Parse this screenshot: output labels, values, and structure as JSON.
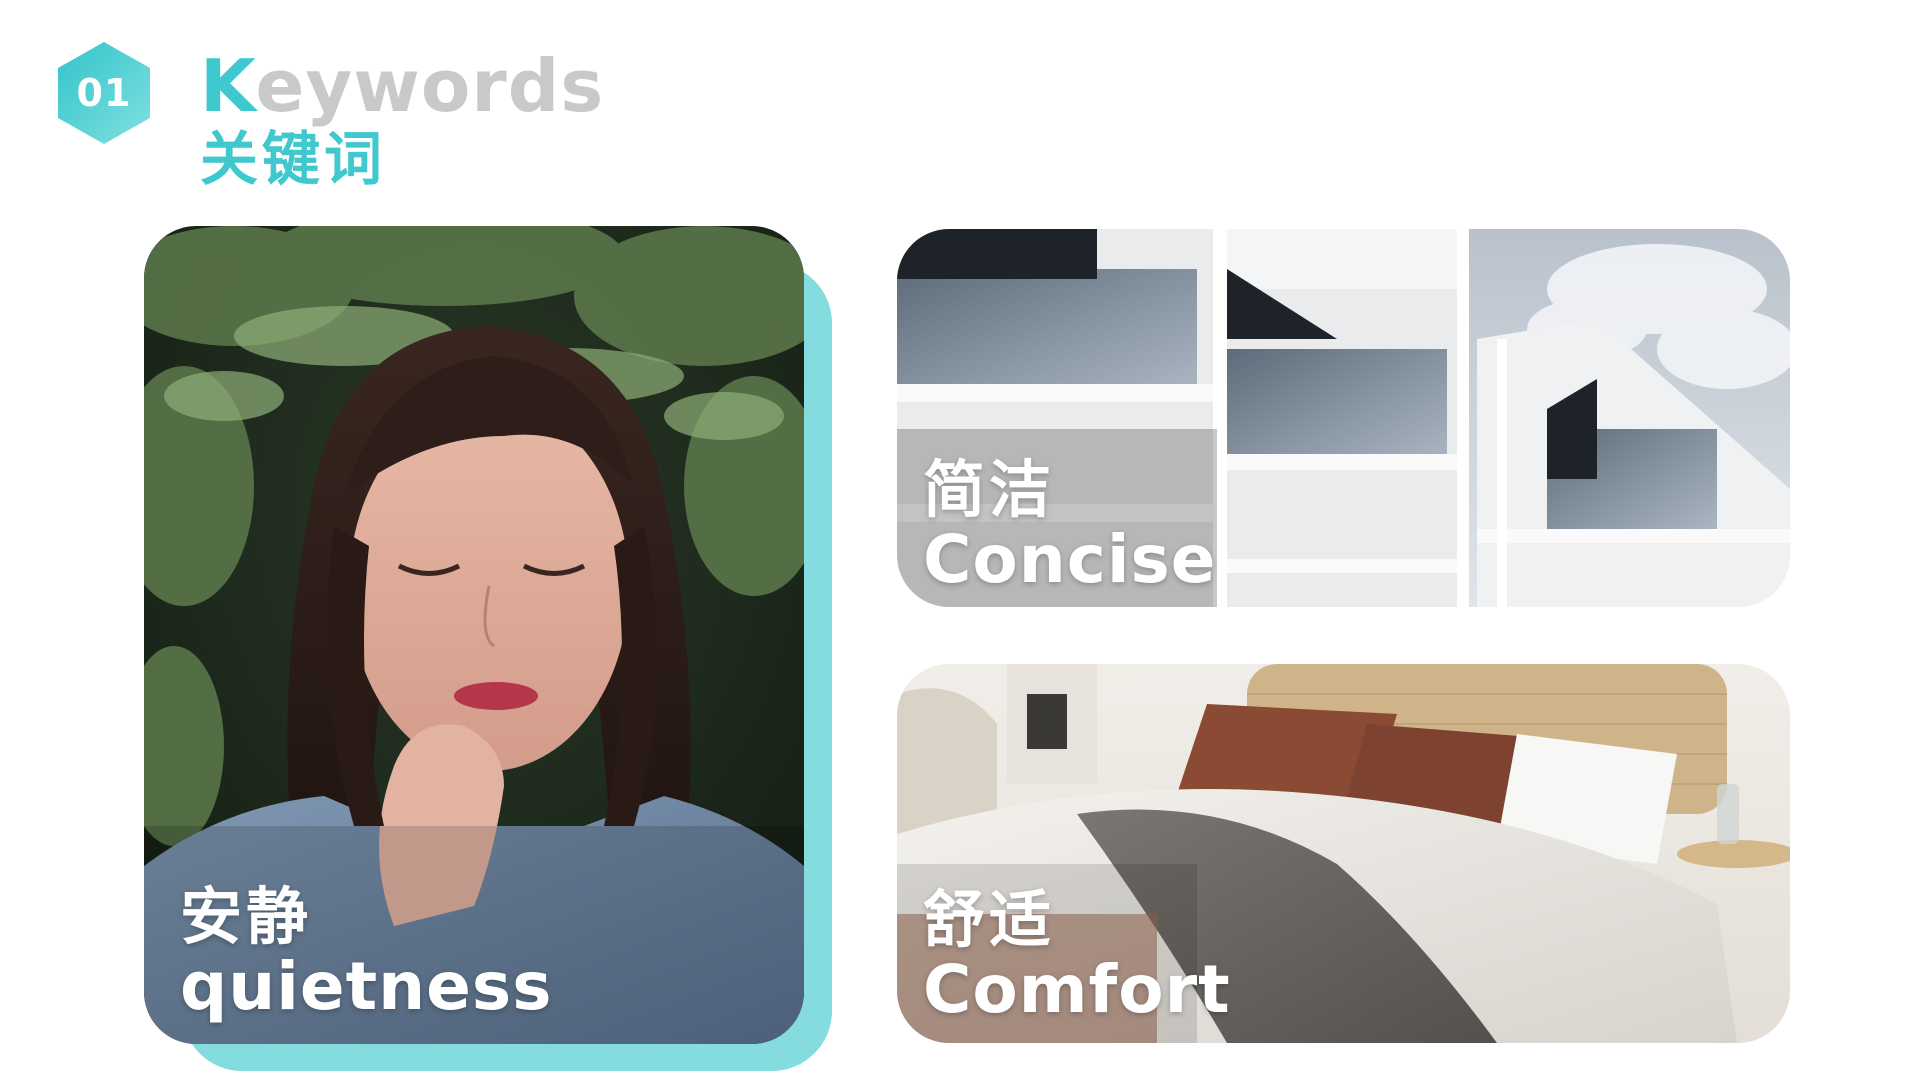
{
  "header": {
    "badge_number": "01",
    "title_en_first": "K",
    "title_en_rest": "eywords",
    "title_cn": "关键词",
    "badge_icon": "hexagon-icon"
  },
  "cards": [
    {
      "name": "quietness",
      "label_cn": "安静",
      "label_en": "quietness",
      "image": "woman-among-pine-branches-photo"
    },
    {
      "name": "concise",
      "label_cn": "简洁",
      "label_en": "Concise",
      "image": "white-modern-building-photo"
    },
    {
      "name": "comfort",
      "label_cn": "舒适",
      "label_en": "Comfort",
      "image": "cozy-bedroom-photo"
    }
  ],
  "colors": {
    "accent": "#3fc8cd",
    "accent_light": "#85dcdf",
    "title_grey": "#c9c9c9",
    "background": "#ffffff"
  }
}
